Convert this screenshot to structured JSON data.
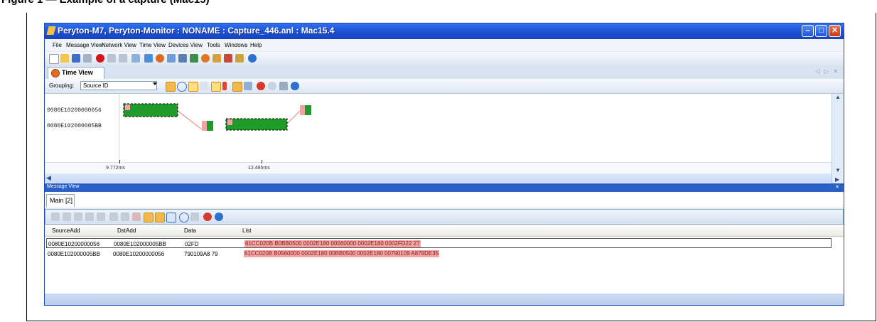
{
  "caption": "Figure 1 — Example of a capture (Mac15)",
  "window": {
    "title": "Peryton-M7, Peryton-Monitor : NONAME : Capture_446.anl : Mac15.4",
    "controls": {
      "minimize": "–",
      "maximize": "□",
      "close": "✕"
    }
  },
  "menu": [
    "File",
    "Message View",
    "Network View",
    "Time View",
    "Devices View",
    "Tools",
    "Windows",
    "Help"
  ],
  "time_view": {
    "tab": "Time View",
    "grouping_label": "Grouping:",
    "grouping_value": "Source ID",
    "rows": [
      "0080E10200000056",
      "0080E102000005BB"
    ],
    "ruler": [
      "9.772ms",
      "12.485ms"
    ],
    "nav": "◁ ▷ ✕"
  },
  "message_view": {
    "title": "Message View",
    "pin": "✕",
    "tab": "Main [2]",
    "columns": [
      "SourceAdd",
      "DstAdd",
      "Data",
      "List"
    ],
    "rows": [
      {
        "source": "0080E10200000056",
        "dst": "0080E102000005BB",
        "data": "02FD",
        "list": "61CC020B B0BB0500 0002E180 00560000 0002E180 0002FD22 27"
      },
      {
        "source": "0080E102000005BB",
        "dst": "0080E10200000056",
        "data": "790109A8 79",
        "list": "61CC020B B0560000 0002E180 00BB0500 0002E180 00790109 A879DE35"
      }
    ]
  },
  "colors": {
    "titlebar": "#2f6ef0",
    "frame_green": "#1f9b2c",
    "highlight": "#f2a3a3"
  }
}
